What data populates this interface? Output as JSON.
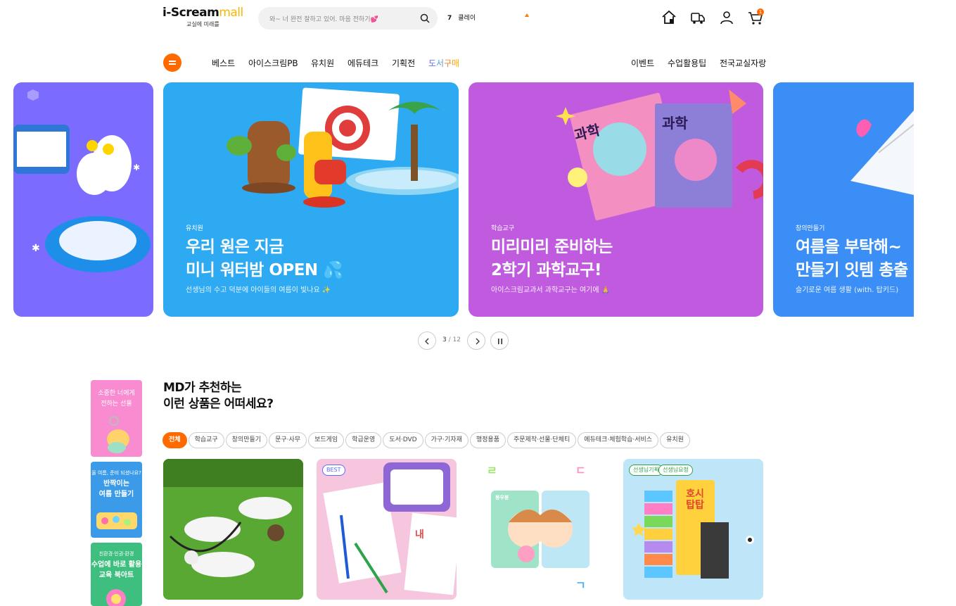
{
  "header": {
    "logo_main_a": "i-Scream",
    "logo_main_b": "mall",
    "logo_sub": "교실에 미래를",
    "search_placeholder": "와~ 너 완전 잘하고 있어. 마음 전하기💕",
    "rank_number": "7",
    "rank_term": "클레이",
    "cart_count": "1",
    "icons": [
      "home-icon",
      "delivery-truck-icon",
      "user-icon",
      "cart-icon",
      "search-icon"
    ]
  },
  "nav": {
    "left": [
      "베스트",
      "아이스크림PB",
      "유치원",
      "에듀테크",
      "기획전",
      "도서구매"
    ],
    "right": [
      "이벤트",
      "수업활용팁",
      "전국교실자랑"
    ]
  },
  "banners": [
    {
      "cat": "",
      "title1": "!",
      "title2": "!",
      "sub": "",
      "color": "#7b6bff"
    },
    {
      "cat": "유치원",
      "title1": "우리 원은 지금",
      "title2": "미니 워터밤 OPEN 💦",
      "sub": "선생님의 수고 덕분에 아이들의 여름이 빛나요 ✨",
      "color": "#2eaaf2"
    },
    {
      "cat": "학습교구",
      "title1": "미리미리 준비하는",
      "title2": "2학기 과학교구!",
      "sub": "아이스크림교과서 과학교구는 여기에 🙏",
      "color": "#c05be0"
    },
    {
      "cat": "창의만들기",
      "title1": "여름을 부탁해~",
      "title2": "만들기 잇템 총출",
      "sub": "슬기로운 여름 생활 (with. 탑키드)",
      "color": "#3a8ef6"
    }
  ],
  "pager": {
    "current": "3",
    "total": "/ 12"
  },
  "side_cards": [
    {
      "text1": "소중한 너에게",
      "text2": "전하는 선물",
      "color": "#f98bd0"
    },
    {
      "small": "올 여름, 준비 되셨나요?",
      "text1": "반짝이는",
      "text2": "여름 만들기",
      "color": "#3c9be8"
    },
    {
      "small": "친환경·인권·환경",
      "text1": "수업에 바로 활용",
      "text2": "교육 북아트",
      "color": "#3fbf7f"
    }
  ],
  "md": {
    "title1": "MD가 추천하는",
    "title2": "이런 상품은 어떠세요?",
    "chips": [
      "전체",
      "학습교구",
      "창의만들기",
      "문구·사무",
      "보드게임",
      "학급운영",
      "도서·DVD",
      "가구·기자재",
      "행정용품",
      "주문제작·선물·단체티",
      "에듀테크·체험학습·서비스",
      "유치원"
    ]
  },
  "products": [
    {
      "badges": []
    },
    {
      "badges": [
        "BEST"
      ]
    },
    {
      "badges": [],
      "inner_text": "봉우봉"
    },
    {
      "badges": [
        "선생님기획",
        "선생님요청"
      ],
      "box_text": "호시 탑탑"
    }
  ]
}
